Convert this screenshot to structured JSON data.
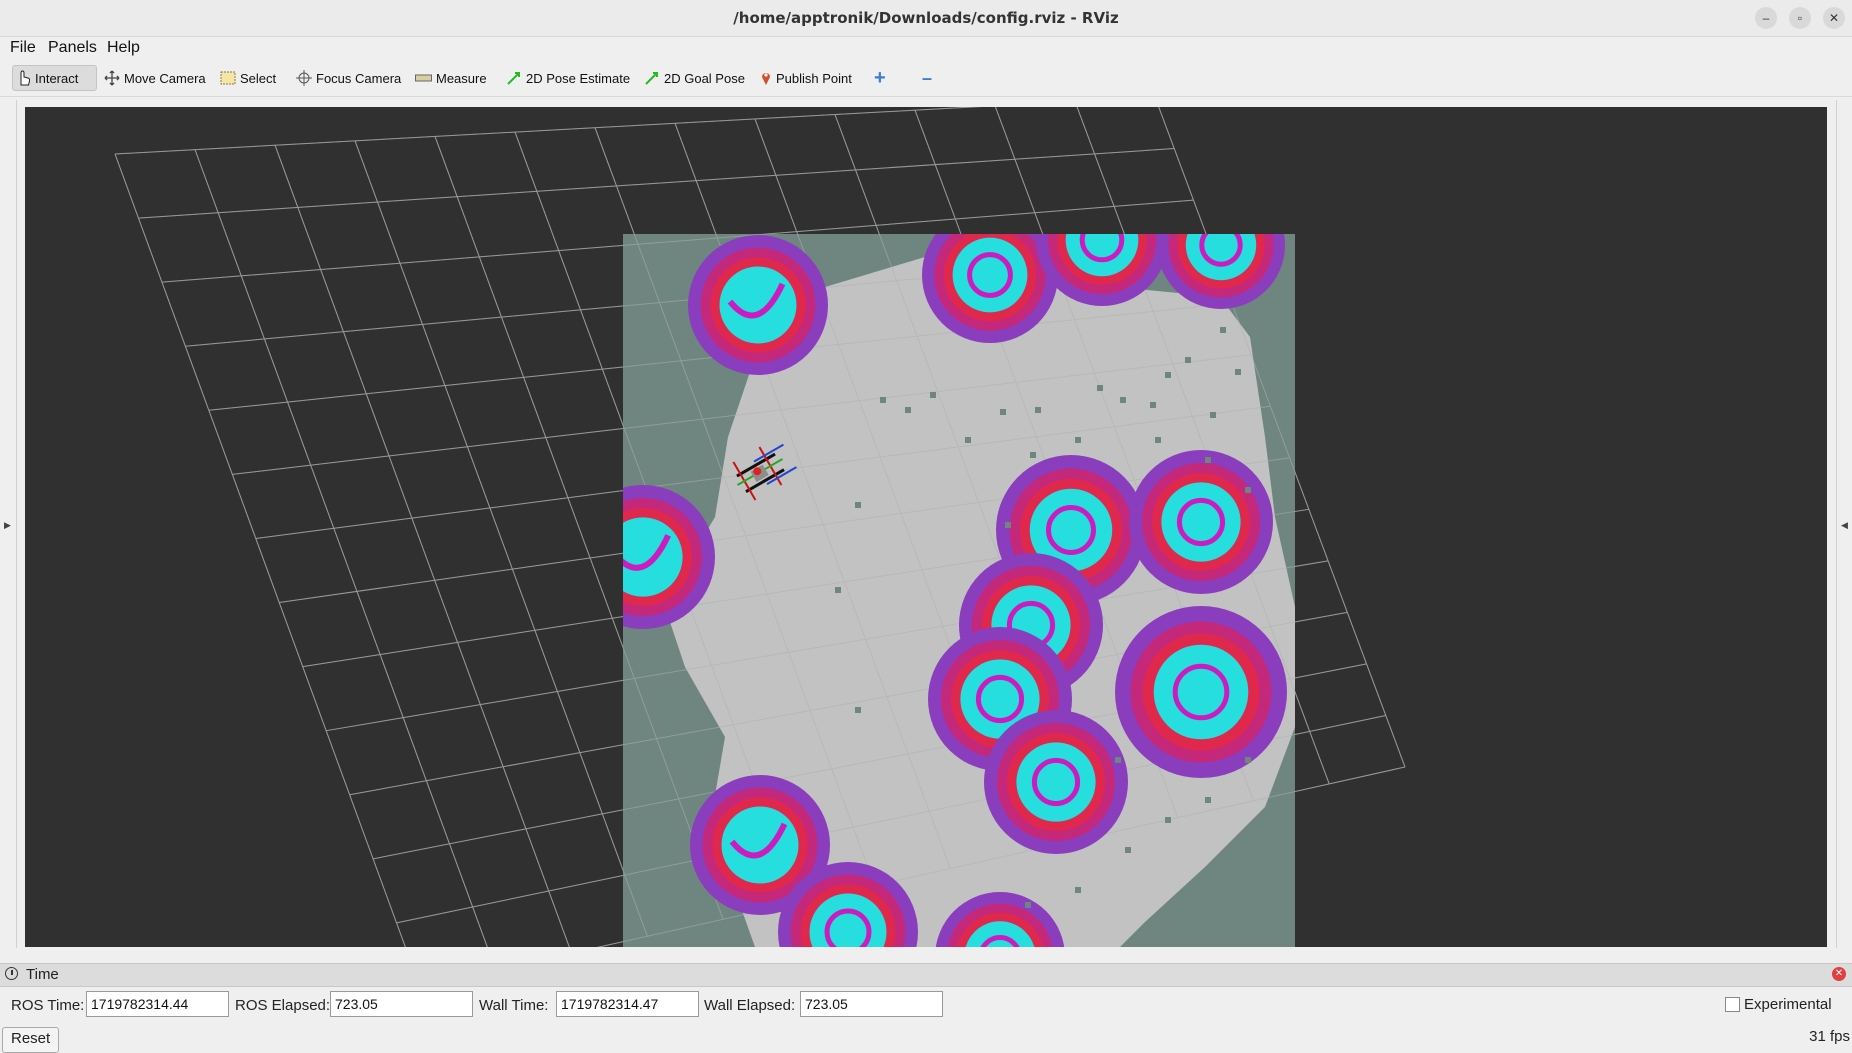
{
  "window": {
    "title": "/home/apptronik/Downloads/config.rviz - RViz",
    "min_symbol": "–",
    "max_symbol": "▫",
    "close_symbol": "✕"
  },
  "menu": {
    "file": "File",
    "panels": "Panels",
    "help": "Help"
  },
  "toolbar": {
    "interact": "Interact",
    "move_camera": "Move Camera",
    "select": "Select",
    "focus_camera": "Focus Camera",
    "measure": "Measure",
    "pose_estimate": "2D Pose Estimate",
    "goal_pose": "2D Goal Pose",
    "publish_point": "Publish Point",
    "add_symbol": "+",
    "remove_symbol": "–"
  },
  "time_panel": {
    "title": "Time",
    "ros_time_label": "ROS Time:",
    "ros_time": "1719782314.44",
    "ros_elapsed_label": "ROS Elapsed:",
    "ros_elapsed": "723.05",
    "wall_time_label": "Wall Time:",
    "wall_time": "1719782314.47",
    "wall_elapsed_label": "Wall Elapsed:",
    "wall_elapsed": "723.05",
    "experimental_label": "Experimental",
    "reset_label": "Reset",
    "fps": "31 fps"
  },
  "colors": {
    "background": "#303030",
    "grid": "#7a7a7a",
    "map_unknown": "#6f8580",
    "map_free": "#c2c2c2",
    "inflation_outer": "#8a3dbd",
    "inflation_mid": "#c4287a",
    "inflation_inner": "#e0284d",
    "inflation_core": "#26dede",
    "obstacle": "#cc1cc0"
  }
}
